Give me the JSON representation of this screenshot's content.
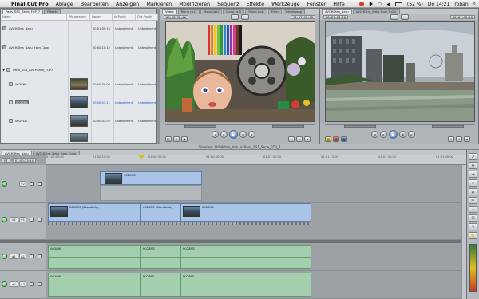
{
  "menubar": {
    "app_name": "Final Cut Pro",
    "items": [
      "Ablage",
      "Bearbeiten",
      "Anzeigen",
      "Markieren",
      "Modifizieren",
      "Sequenz",
      "Effekte",
      "Werkzeuge",
      "Fenster",
      "Hilfe"
    ],
    "battery": "(52 %)",
    "clock": "Do 14:21",
    "user": "roban"
  },
  "browser": {
    "tabs": [
      "Paris_SS1_Serie_FCP_7",
      "Effekte"
    ],
    "columns": [
      "Name",
      "Piktogramm",
      "Dauer",
      "In-Punkt",
      "Out-Punkt"
    ],
    "rows": [
      {
        "name": "AVCHDtra_Natu",
        "duration": "00:01:09:16",
        "in": "Unbestimmt",
        "out": "Unbestimmt"
      },
      {
        "name": "AVCHDtra_Natu from Color",
        "duration": "00:00:10:12",
        "in": "Unbestimmt",
        "out": "Unbestimmt"
      },
      {
        "name": "Paris_SS1_AVCHDtra_FCP7",
        "duration": "",
        "in": "",
        "out": ""
      },
      {
        "name": "0028HF",
        "duration": "00:00:30:00",
        "in": "Unbestimmt",
        "out": "Unbestimmt"
      },
      {
        "name": "00289S",
        "duration": "00:00:03:21",
        "in": "Unbestimmt",
        "out": "Unbestimmt"
      },
      {
        "name": "00291B",
        "duration": "00:00:41:02",
        "in": "Unbestimmt",
        "out": "Unbestimmt"
      }
    ]
  },
  "viewer": {
    "tabs": [
      "Video",
      "Mono (a1)",
      "Mono (a2)",
      "Mono (a3)",
      "Mono (a4)",
      "Filter",
      "Bewegung"
    ],
    "timecode_left": "00:00:30:06",
    "timecode_right": "17:22:59:19"
  },
  "canvas": {
    "tabs": [
      "AVCHDtra_Natu",
      "AVCHDtra_Natu from Color"
    ],
    "timecode_left": "00:01:09:16",
    "timecode_right": "00:01:09:16"
  },
  "timeline": {
    "title": "Timeline: AVCHDtra_Natu in Paris_SS1_Serie_FCP_7",
    "tabs": [
      "AVCHDtra_Natu",
      "AVCHDtra_Natu from Color"
    ],
    "rt_label": "RT",
    "current_timecode": "01:00:23:14",
    "ruler_ticks": [
      "01:00:00:00",
      "01:00:15:00",
      "01:00:30:00",
      "01:00:45:00",
      "01:01:00:00",
      "01:01:15:00",
      "01:01:30:00",
      "01:01:45:00"
    ],
    "tracks": [
      {
        "id": "v2",
        "label": "V2"
      },
      {
        "id": "v1",
        "src": "v1",
        "label": "V1"
      },
      {
        "id": "a1",
        "src": "a1",
        "label": "A1"
      },
      {
        "id": "a2",
        "src": "a2",
        "label": "A2"
      }
    ],
    "clips": {
      "v2": "00289S",
      "v1a": "00289S (Standbild)",
      "v1b": "00289S (Standbild)",
      "v1c": "00289S",
      "a1a": "00289S",
      "a1b": "00289S",
      "a1c": "00289S",
      "a2a": "00289S",
      "a2b": "00289S",
      "a2c": "00289S"
    }
  }
}
